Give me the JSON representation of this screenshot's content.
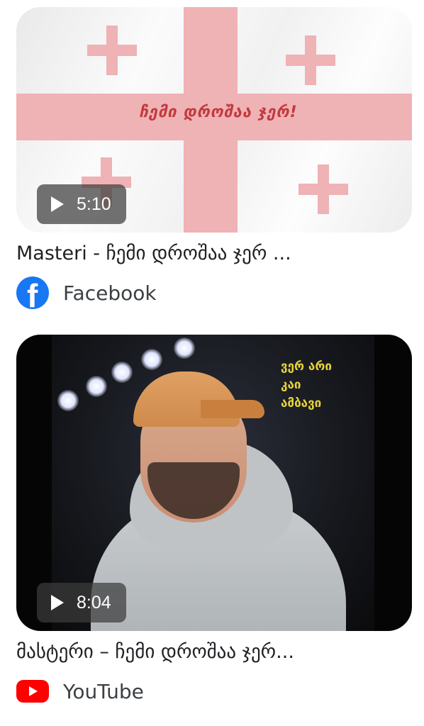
{
  "results": [
    {
      "duration": "5:10",
      "thumbnail_caption": "ჩემი დროშაა ჯერ!",
      "title": "Masteri - ჩემი დროშაა ჯერ ...",
      "source": "Facebook",
      "source_icon": "facebook-icon"
    },
    {
      "duration": "8:04",
      "thumbnail_caption_lines": [
        "ვერ არი",
        "კაი",
        "ამბავი"
      ],
      "title": "მასტერი – ჩემი დროშაა ჯერ...",
      "source": "YouTube",
      "source_icon": "youtube-icon"
    }
  ],
  "colors": {
    "flag_red": "#efb2b5",
    "facebook_blue": "#1877f2",
    "youtube_red": "#ff0000",
    "caption_yellow": "#e8d23a"
  }
}
